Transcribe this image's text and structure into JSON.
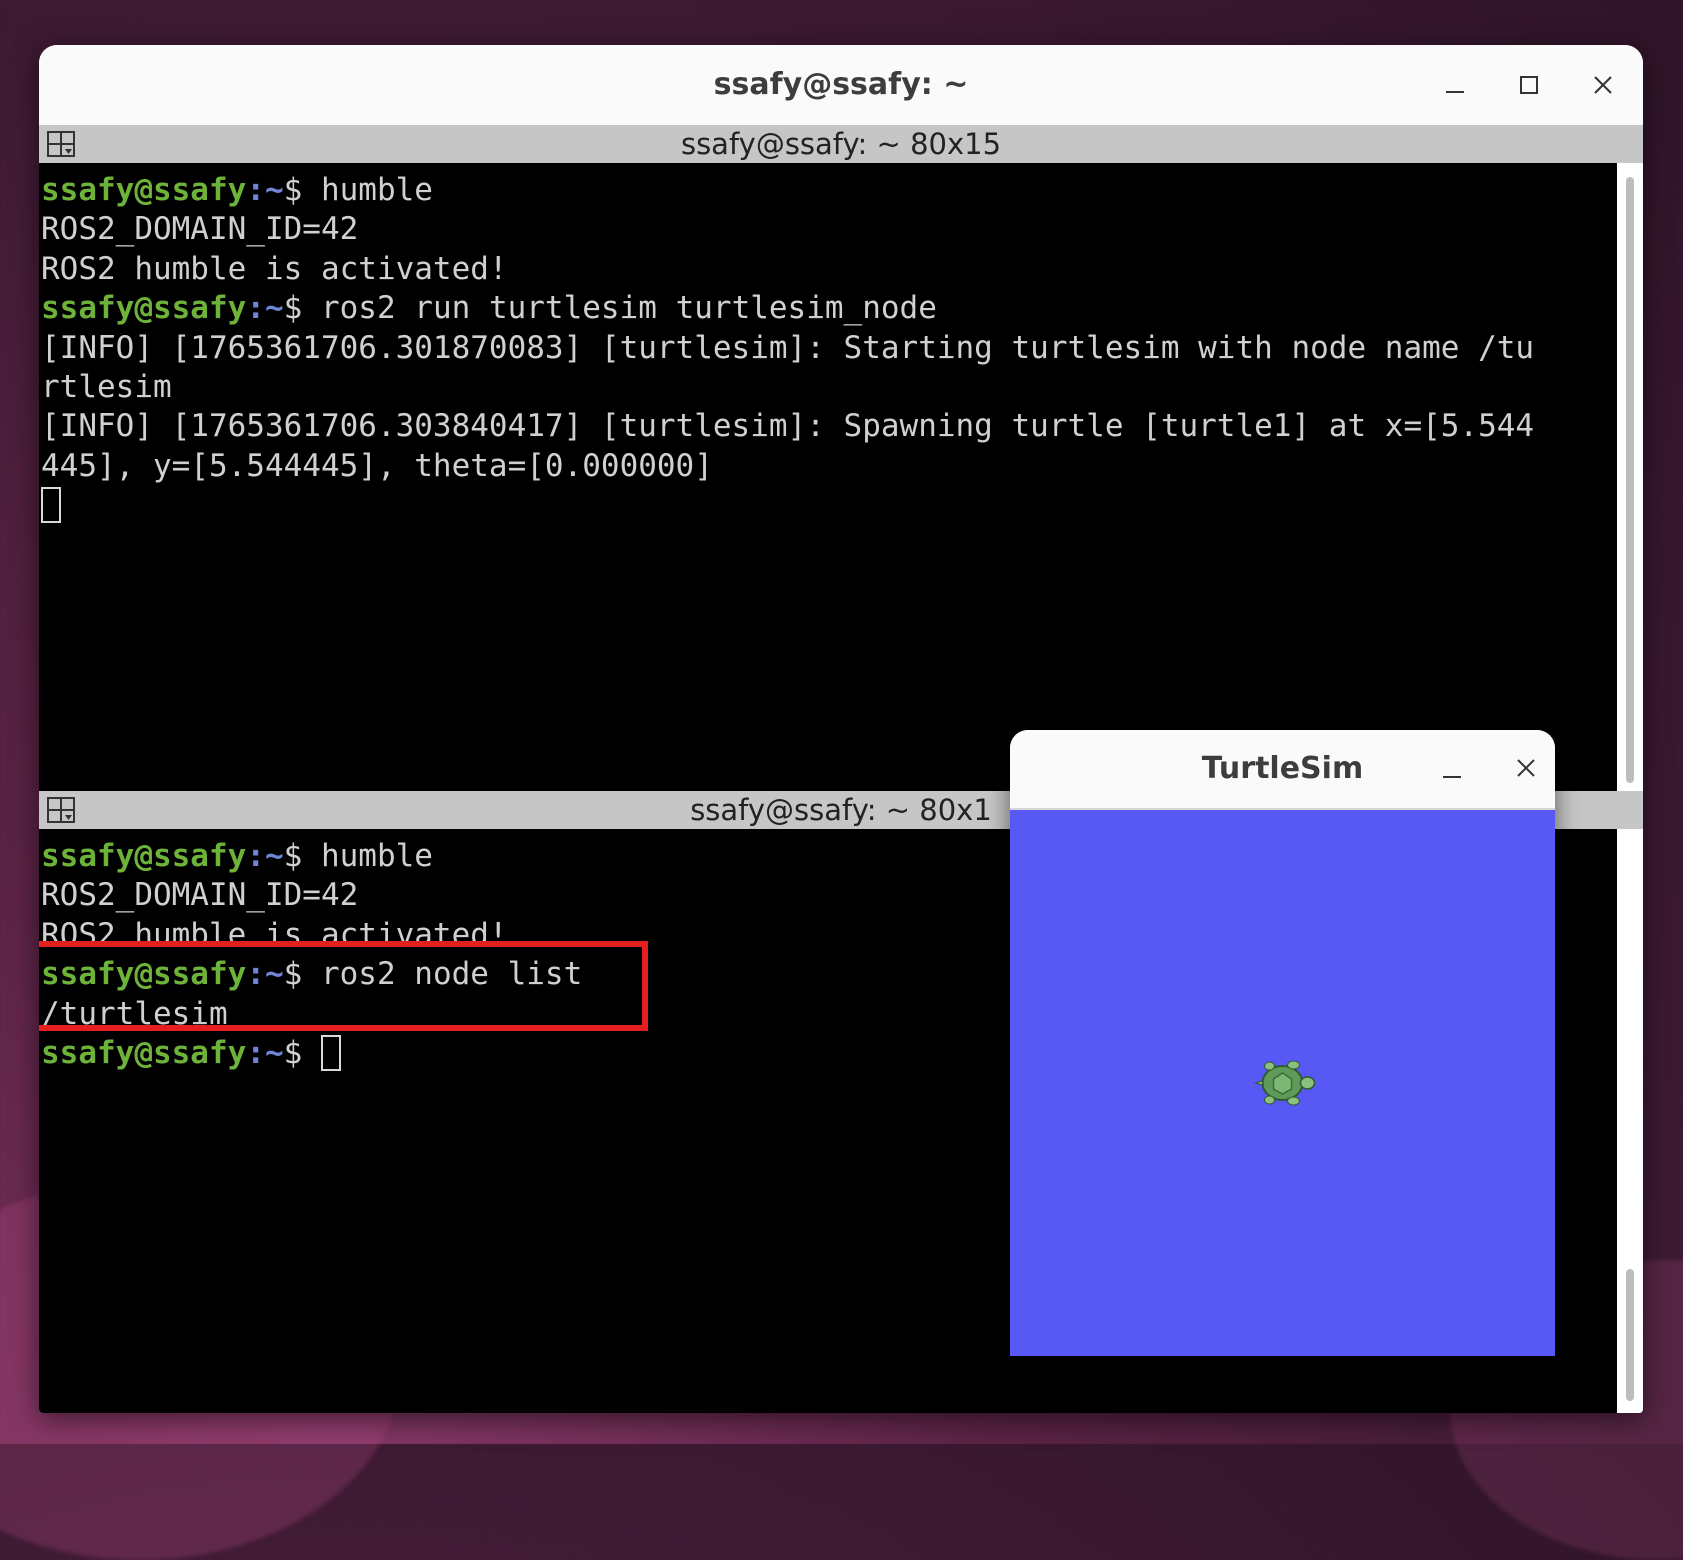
{
  "window": {
    "title": "ssafy@ssafy: ~",
    "buttons": {
      "minimize": "minimize-icon",
      "maximize": "maximize-icon",
      "close": "close-icon"
    }
  },
  "top_pane": {
    "title": "ssafy@ssafy: ~ 80x15",
    "lines": [
      {
        "user": "ssafy@ssafy",
        "path": ":~",
        "sym": "$ ",
        "cmd": "humble"
      },
      {
        "text": "ROS2_DOMAIN_ID=42"
      },
      {
        "text": "ROS2 humble is activated!"
      },
      {
        "user": "ssafy@ssafy",
        "path": ":~",
        "sym": "$ ",
        "cmd": "ros2 run turtlesim turtlesim_node"
      },
      {
        "text": "[INFO] [1765361706.301870083] [turtlesim]: Starting turtlesim with node name /tu"
      },
      {
        "text": "rtlesim"
      },
      {
        "text": "[INFO] [1765361706.303840417] [turtlesim]: Spawning turtle [turtle1] at x=[5.544"
      },
      {
        "text": "445], y=[5.544445], theta=[0.000000]"
      }
    ]
  },
  "bottom_pane": {
    "title": "ssafy@ssafy: ~ 80x1",
    "lines": [
      {
        "user": "ssafy@ssafy",
        "path": ":~",
        "sym": "$ ",
        "cmd": "humble"
      },
      {
        "text": "ROS2_DOMAIN_ID=42"
      },
      {
        "text": "ROS2 humble is activated!"
      },
      {
        "user": "ssafy@ssafy",
        "path": ":~",
        "sym": "$ ",
        "cmd": "ros2 node list"
      },
      {
        "text": "/turtlesim"
      },
      {
        "user": "ssafy@ssafy",
        "path": ":~",
        "sym": "$ ",
        "cmd": ""
      }
    ]
  },
  "turtlesim": {
    "title": "TurtleSim",
    "background_color": "#5858f4",
    "turtle": {
      "name": "turtle1",
      "x": 5.544445,
      "y": 5.544445,
      "theta": 0.0
    }
  },
  "colors": {
    "prompt_user": "#6db33a",
    "prompt_path": "#6f86d6",
    "highlight": "#e41f1f"
  }
}
